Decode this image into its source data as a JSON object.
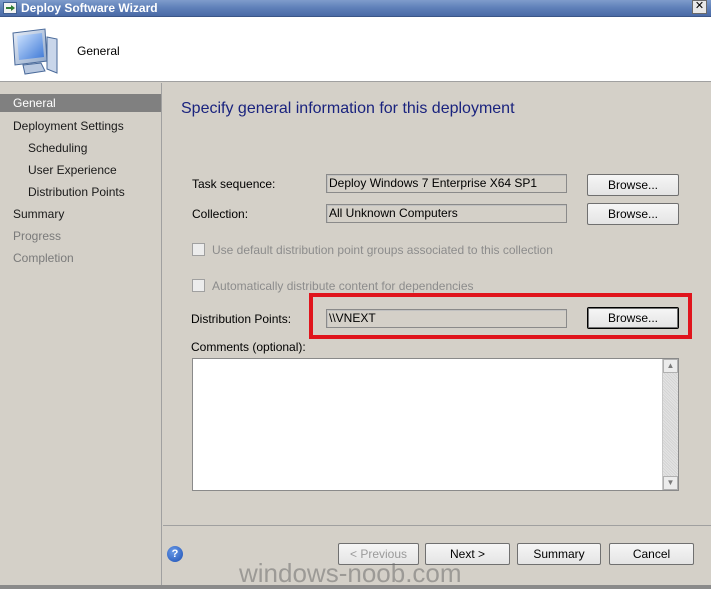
{
  "window": {
    "title": "Deploy Software Wizard",
    "close_glyph": "✕"
  },
  "header": {
    "title": "General",
    "icon": "computer-monitor-icon"
  },
  "sidebar": {
    "items": [
      {
        "label": "General",
        "state": "selected"
      },
      {
        "label": "Deployment Settings",
        "state": "normal"
      },
      {
        "label": "Scheduling",
        "state": "normal"
      },
      {
        "label": "User Experience",
        "state": "normal"
      },
      {
        "label": "Distribution Points",
        "state": "normal"
      },
      {
        "label": "Summary",
        "state": "normal"
      },
      {
        "label": "Progress",
        "state": "disabled"
      },
      {
        "label": "Completion",
        "state": "disabled"
      }
    ]
  },
  "main": {
    "heading": "Specify general information for this deployment",
    "task_sequence": {
      "label": "Task sequence:",
      "value": "Deploy Windows 7 Enterprise X64 SP1",
      "button": "Browse..."
    },
    "collection": {
      "label": "Collection:",
      "value": "All Unknown Computers",
      "button": "Browse..."
    },
    "checkbox_default_groups": {
      "label": "Use default distribution point groups associated to this collection",
      "checked": false,
      "enabled": false
    },
    "checkbox_auto_distribute": {
      "label": "Automatically distribute content for dependencies",
      "checked": false,
      "enabled": false
    },
    "distribution_points": {
      "label": "Distribution Points:",
      "value": "\\\\VNEXT",
      "button": "Browse..."
    },
    "comments": {
      "label": "Comments (optional):",
      "value": ""
    }
  },
  "footer": {
    "previous": "< Previous",
    "next": "Next >",
    "summary": "Summary",
    "cancel": "Cancel"
  },
  "watermark": "windows-noob.com",
  "colors": {
    "highlight": "#e0141c",
    "heading": "#1a237e",
    "selected_nav": "#808080"
  }
}
